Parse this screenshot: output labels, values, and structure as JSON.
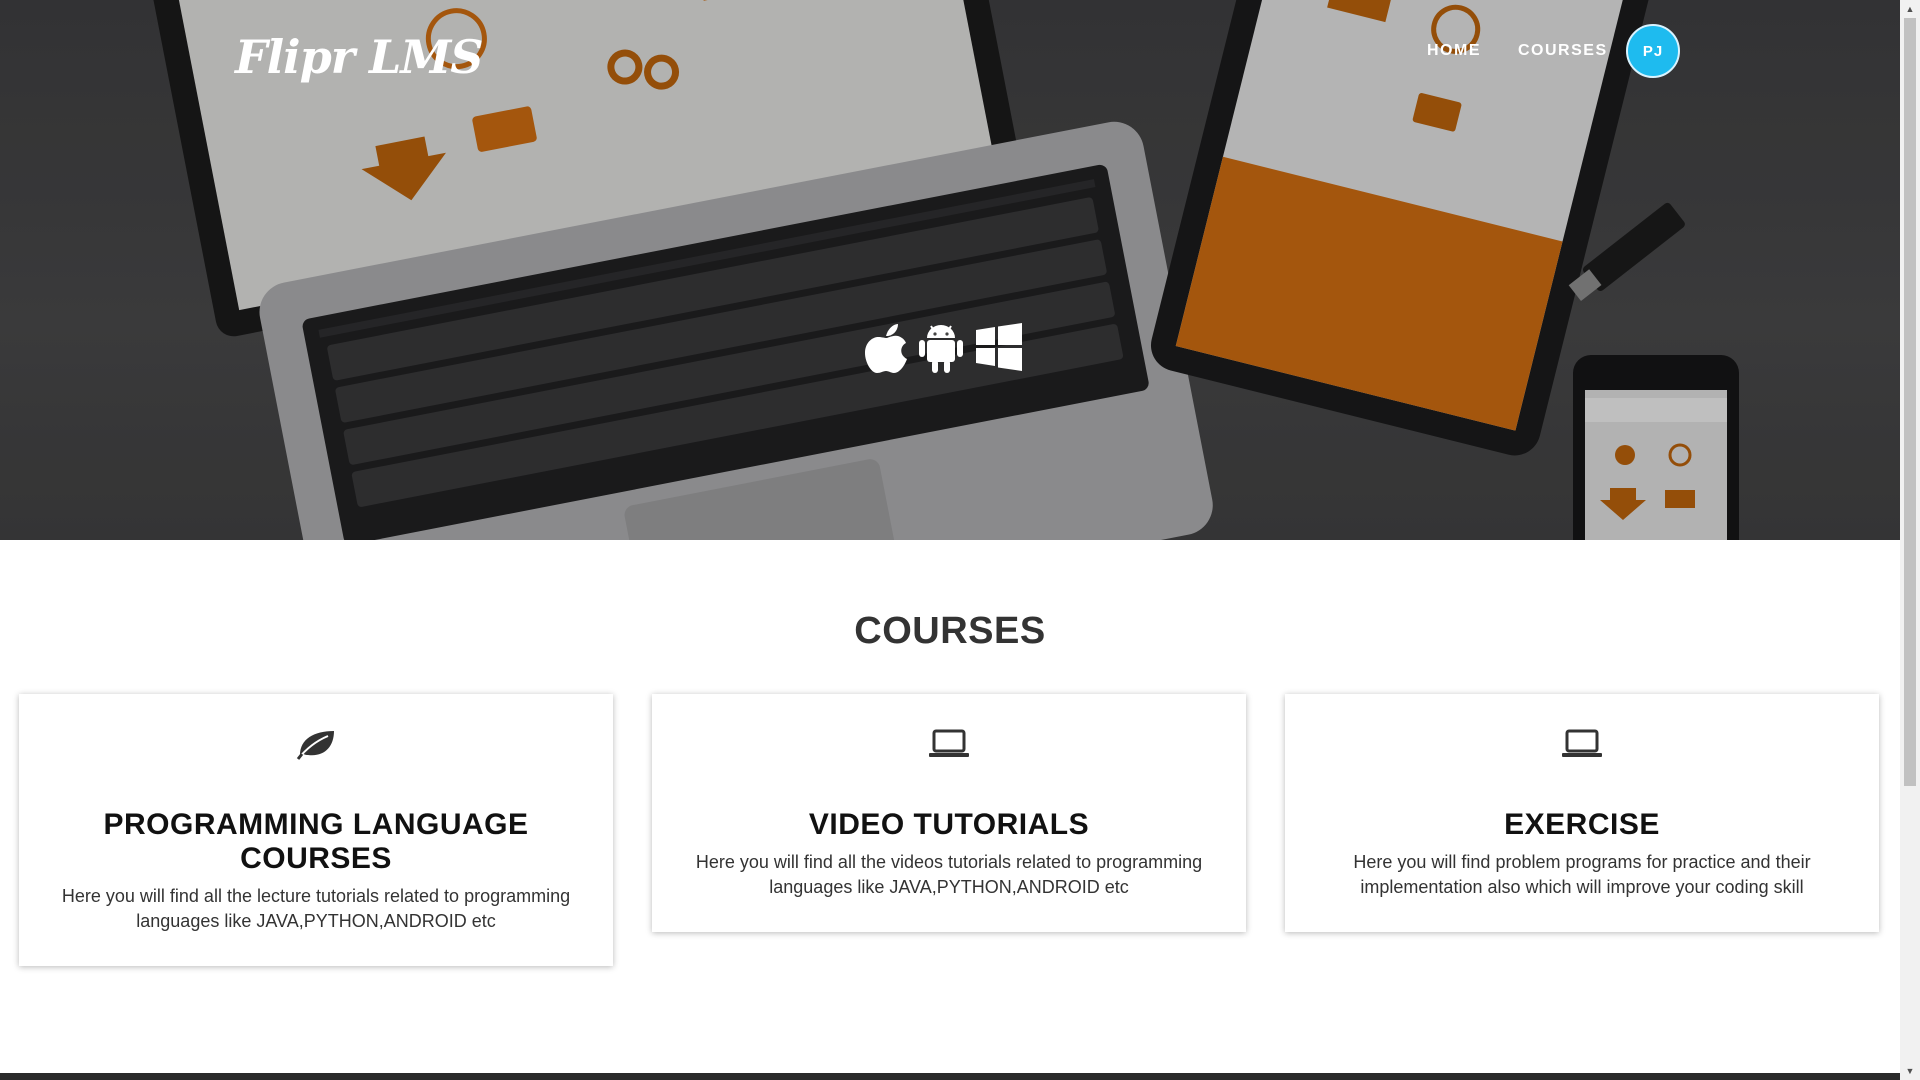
{
  "header": {
    "brand": "Flipr LMS",
    "nav": {
      "home": "HOME",
      "courses": "COURSES"
    },
    "avatar_initials": "PJ",
    "avatar_color": "#1ebbef"
  },
  "hero": {
    "platform_icons": [
      "apple-icon",
      "android-icon",
      "windows-icon"
    ]
  },
  "courses": {
    "heading": "COURSES",
    "cards": [
      {
        "icon": "leaf-icon",
        "title": "PROGRAMMING LANGUAGE COURSES",
        "text": "Here you will find all the lecture tutorials related to programming languages like JAVA,PYTHON,ANDROID etc"
      },
      {
        "icon": "laptop-icon",
        "title": "VIDEO TUTORIALS",
        "text": "Here you will find all the videos tutorials related to programming languages like JAVA,PYTHON,ANDROID etc"
      },
      {
        "icon": "laptop-icon",
        "title": "EXERCISE",
        "text": "Here you will find problem programs for practice and their implementation also which will improve your coding skill"
      }
    ]
  },
  "colors": {
    "hero_overlay": "#3e3e40",
    "accent_orange": "#e07a10",
    "footer": "#2a2a2a"
  }
}
